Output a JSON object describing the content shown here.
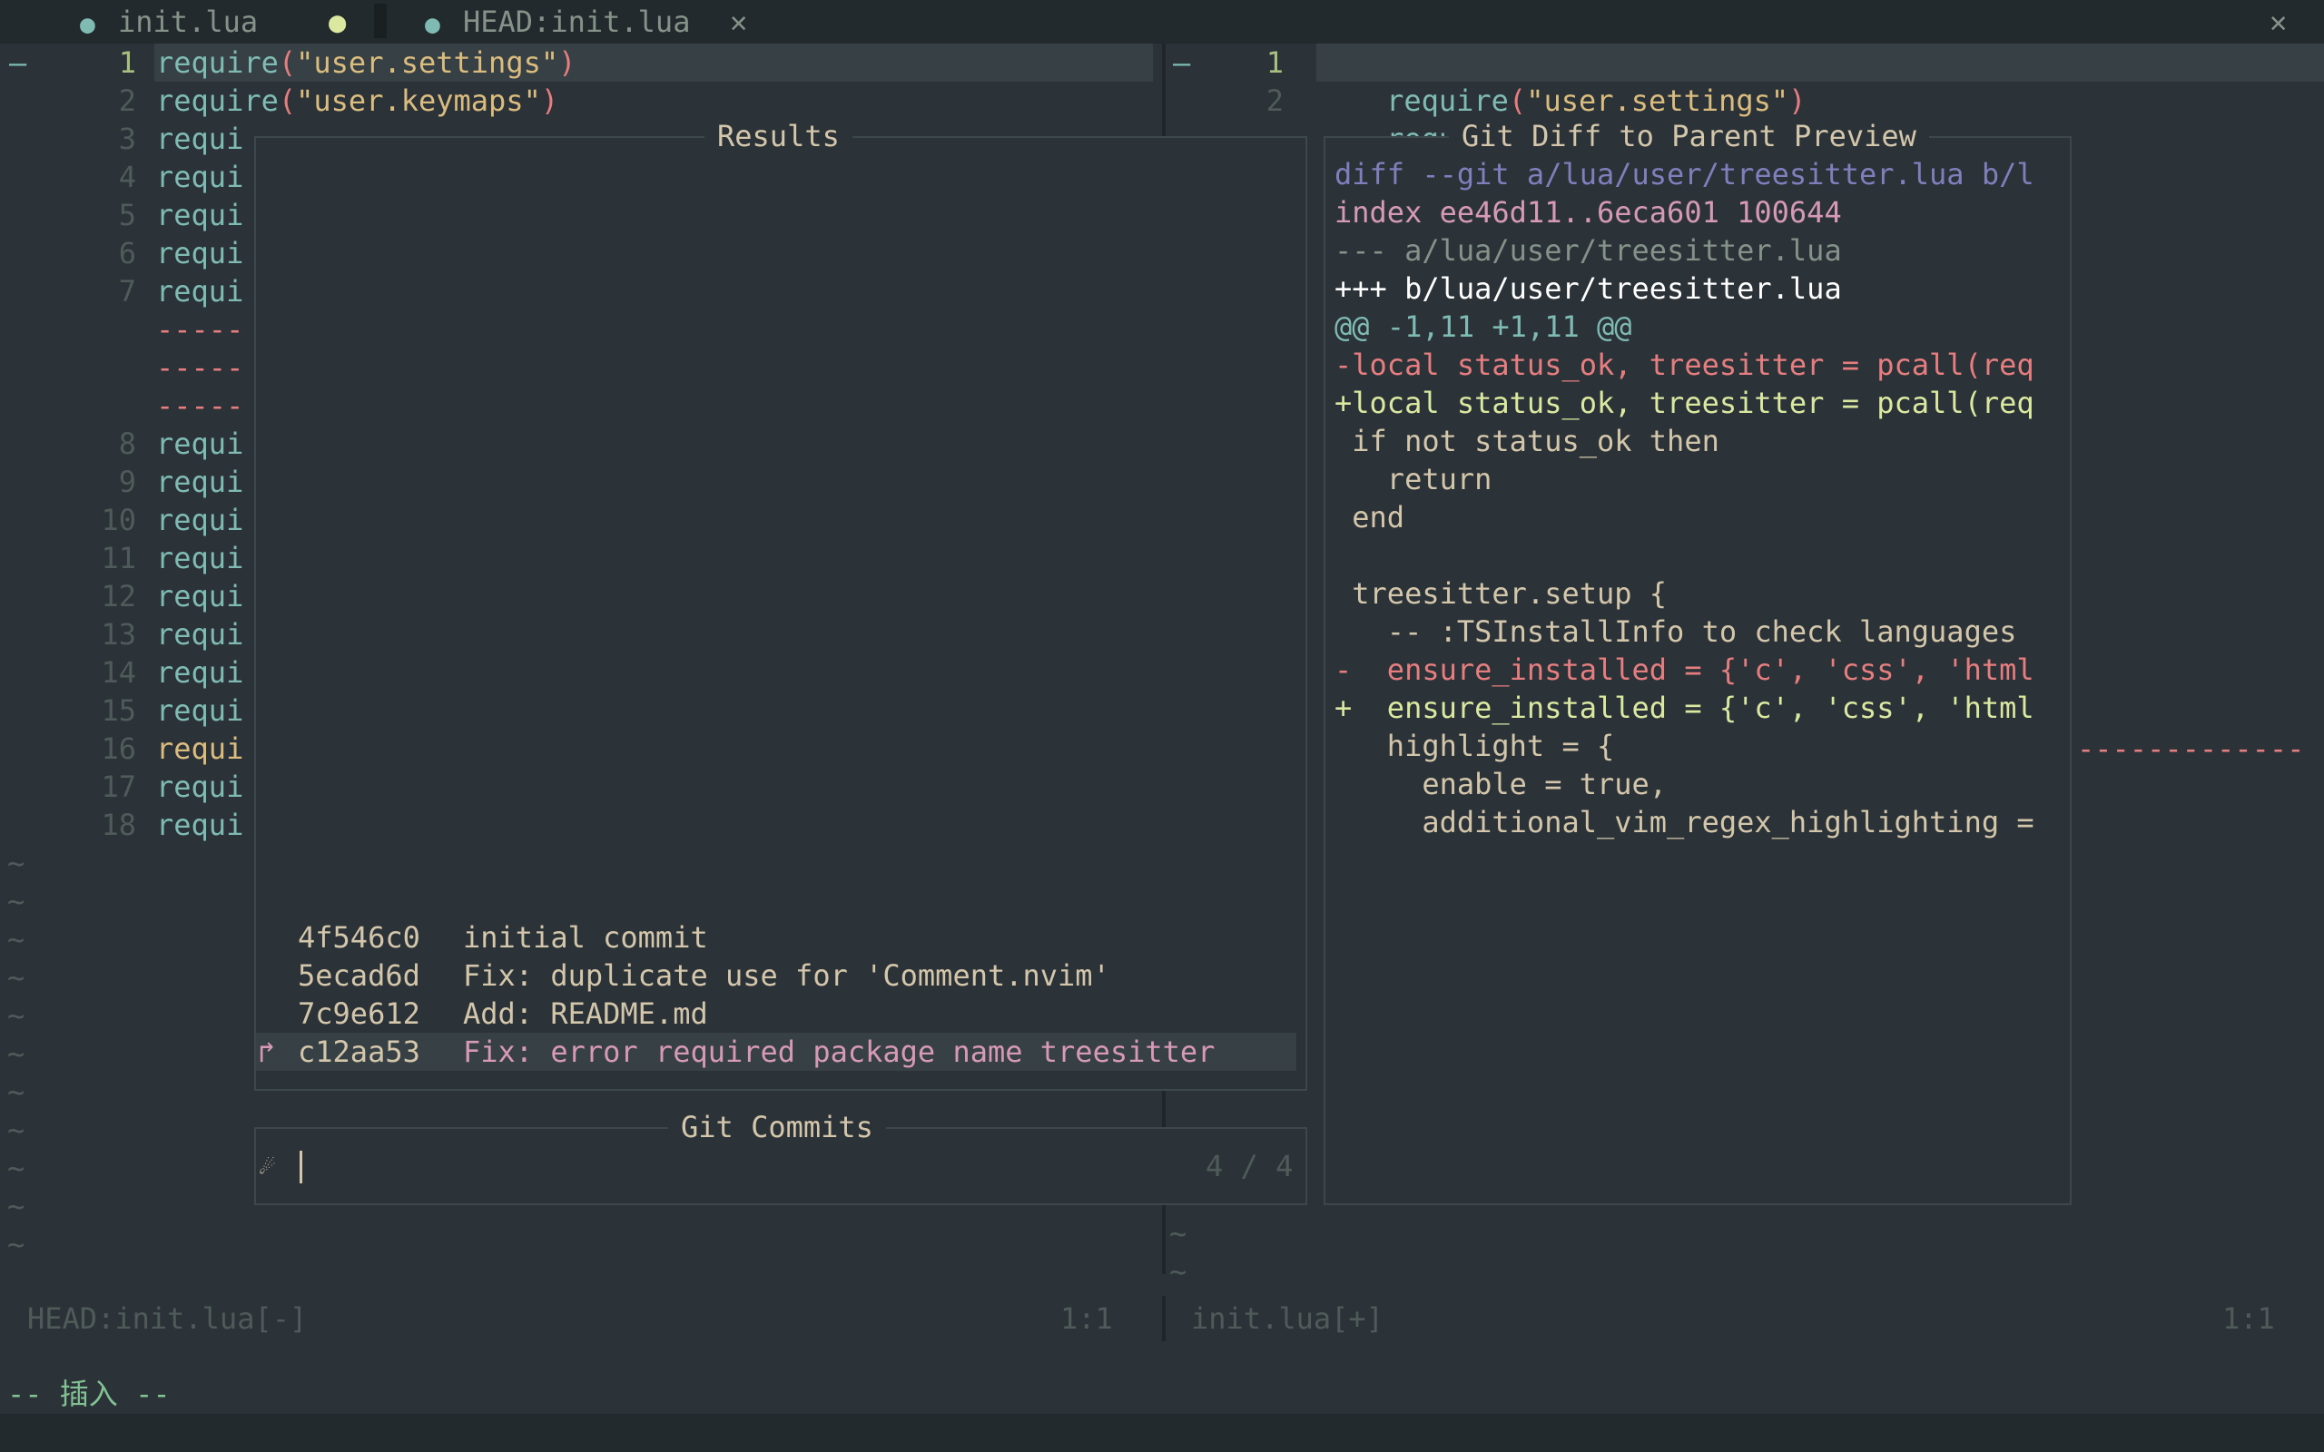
{
  "colors": {
    "bg": "#2b3339",
    "accent": "#a7c080",
    "string": "#dbbc7f",
    "add": "#a7c080",
    "del": "#e67e80",
    "purple": "#d699b6",
    "blue": "#7fbbb3"
  },
  "tabs": [
    {
      "icon": "lua-icon",
      "label": "init.lua",
      "modified": "●"
    },
    {
      "icon": "lua-icon",
      "label": "HEAD:init.lua",
      "close": "✕"
    }
  ],
  "window_close": "✕",
  "left_pane": {
    "fold_marker": "–",
    "lines": [
      {
        "num": "1",
        "text": "require(\"user.settings\")"
      },
      {
        "num": "2",
        "text": "require(\"user.keymaps\")"
      },
      {
        "num": "3",
        "text": "requi"
      },
      {
        "num": "4",
        "text": "requi"
      },
      {
        "num": "5",
        "text": "requi"
      },
      {
        "num": "6",
        "text": "requi"
      },
      {
        "num": "7",
        "text": "requi"
      },
      {
        "num": "",
        "text": "-----"
      },
      {
        "num": "",
        "text": "-----"
      },
      {
        "num": "",
        "text": "-----"
      },
      {
        "num": "8",
        "text": "requi"
      },
      {
        "num": "9",
        "text": "requi"
      },
      {
        "num": "10",
        "text": "requi"
      },
      {
        "num": "11",
        "text": "requi"
      },
      {
        "num": "12",
        "text": "requi"
      },
      {
        "num": "13",
        "text": "requi"
      },
      {
        "num": "14",
        "text": "requi"
      },
      {
        "num": "15",
        "text": "requi"
      },
      {
        "num": "16",
        "text": "requi"
      },
      {
        "num": "17",
        "text": "requi"
      },
      {
        "num": "18",
        "text": "requi"
      }
    ],
    "status_file": "HEAD:init.lua[-]",
    "status_pos": "1:1"
  },
  "right_pane": {
    "fold_marker": "–",
    "line1": {
      "num": "1",
      "text": "require(\"user.settings\")"
    },
    "line2": {
      "num": "2",
      "text": "require(\"user.keymaps\")"
    },
    "filler": "-------------",
    "status_file": "init.lua[+]",
    "status_pos": "1:1"
  },
  "results": {
    "title": "Results",
    "commits": [
      {
        "hash": "4f546c0",
        "message": "initial commit"
      },
      {
        "hash": "5ecad6d",
        "message": "Fix: duplicate use for 'Comment.nvim'"
      },
      {
        "hash": "7c9e612",
        "message": "Add: README.md"
      },
      {
        "hash": "c12aa53",
        "message": "Fix: error required package name treesitter",
        "selected": true
      }
    ],
    "caret": "↱"
  },
  "prompt": {
    "title": "Git Commits",
    "icon": "telescope-icon",
    "value": "",
    "counter": "4 / 4"
  },
  "preview": {
    "title": "Git Diff to Parent Preview",
    "lines": [
      {
        "text": "diff --git a/lua/user/treesitter.lua b/l",
        "kind": "meta"
      },
      {
        "text": "index ee46d11..6eca601 100644",
        "kind": "index"
      },
      {
        "text": "--- a/lua/user/treesitter.lua",
        "kind": "oldfile"
      },
      {
        "text": "+++ b/lua/user/treesitter.lua",
        "kind": "newfile"
      },
      {
        "text": "@@ -1,11 +1,11 @@",
        "kind": "hunk"
      },
      {
        "text": "-local status_ok, treesitter = pcall(req",
        "kind": "del"
      },
      {
        "text": "+local status_ok, treesitter = pcall(req",
        "kind": "add"
      },
      {
        "text": " if not status_ok then",
        "kind": "ctx"
      },
      {
        "text": "   return",
        "kind": "ctx"
      },
      {
        "text": " end",
        "kind": "ctx"
      },
      {
        "text": "",
        "kind": "ctx"
      },
      {
        "text": " treesitter.setup {",
        "kind": "ctx"
      },
      {
        "text": "   -- :TSInstallInfo to check languages",
        "kind": "ctx"
      },
      {
        "text": "-  ensure_installed = {'c', 'css', 'html",
        "kind": "del"
      },
      {
        "text": "+  ensure_installed = {'c', 'css', 'html",
        "kind": "add"
      },
      {
        "text": "   highlight = {",
        "kind": "ctx"
      },
      {
        "text": "     enable = true,",
        "kind": "ctx"
      },
      {
        "text": "     additional_vim_regex_highlighting =",
        "kind": "ctx"
      }
    ]
  },
  "mode_line": "-- 插入 --"
}
